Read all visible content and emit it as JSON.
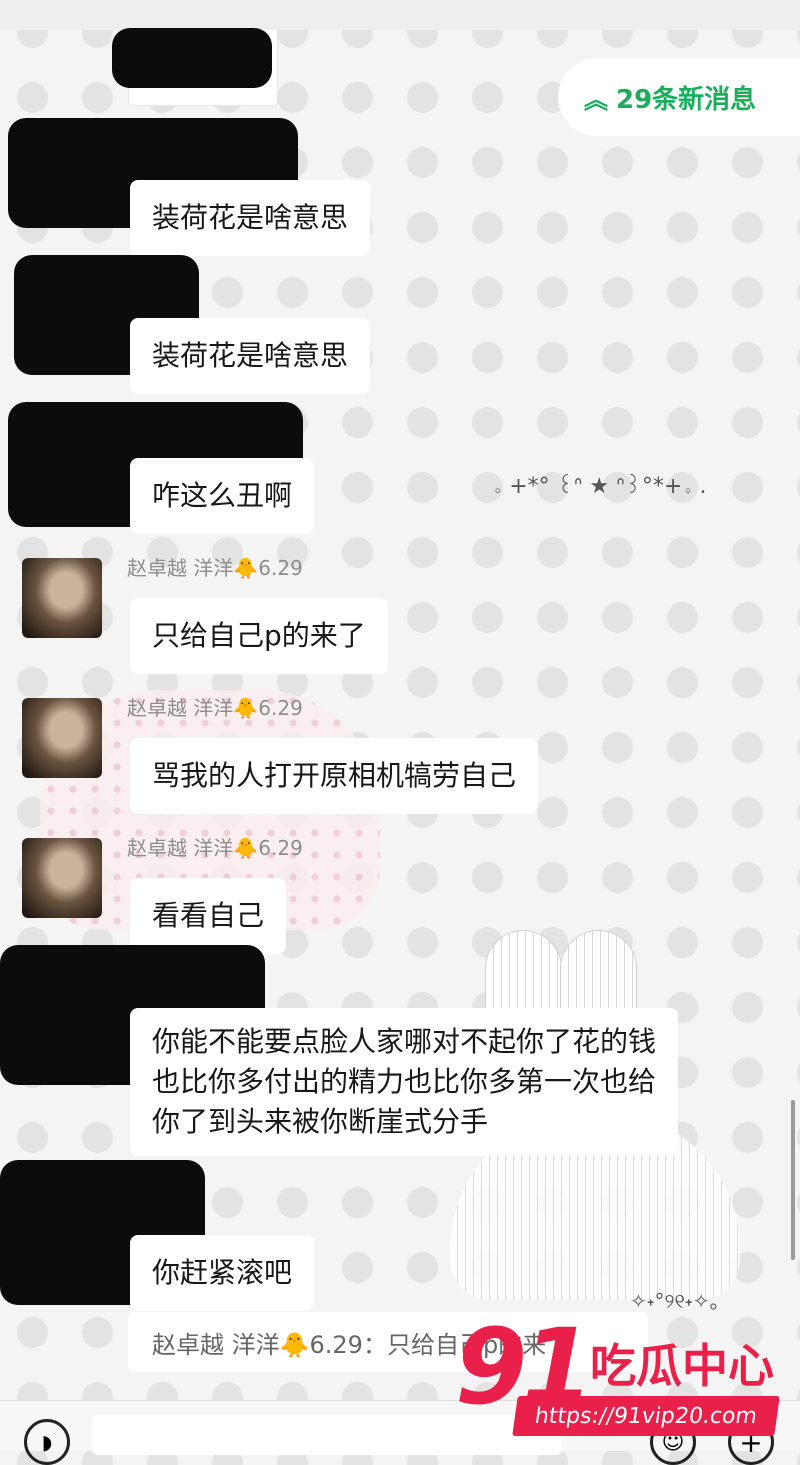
{
  "new_messages": {
    "label": "29条新消息"
  },
  "colors": {
    "accent": "#1aad5c",
    "watermark": "#e8204a",
    "bubble": "#ffffff"
  },
  "decorations": {
    "kaomoji_1": "。+*° ꒰ᐢ ★ ᐢ꒱°*+。.",
    "kaomoji_2": "✧˖°୨୧˖✧。"
  },
  "messages": [
    {
      "sender": "",
      "text": "装荷花是啥意思"
    },
    {
      "sender": "",
      "text": "装荷花是啥意思"
    },
    {
      "sender": "",
      "text": "咋这么丑啊"
    },
    {
      "sender": "赵卓越  洋洋🐥6.29",
      "text": "只给自己p的来了"
    },
    {
      "sender": "赵卓越  洋洋🐥6.29",
      "text": "骂我的人打开原相机犒劳自己"
    },
    {
      "sender": "赵卓越  洋洋🐥6.29",
      "text": "看看自己"
    },
    {
      "sender": "",
      "text": "你能不能要点脸人家哪对不起你了花的钱也比你多付出的精力也比你多第一次也给你了到头来被你断崖式分手"
    },
    {
      "sender": "",
      "text": "你赶紧滚吧"
    }
  ],
  "quote": {
    "text": "赵卓越  洋洋🐥6.29：只给自己p的来了"
  },
  "input_bar": {
    "voice_icon": "voice-icon",
    "emoji_icon": "emoji-icon",
    "plus_icon": "plus-icon"
  },
  "watermark": {
    "number": "91",
    "brand": "吃瓜中心",
    "url": "https://91vip20.com"
  }
}
